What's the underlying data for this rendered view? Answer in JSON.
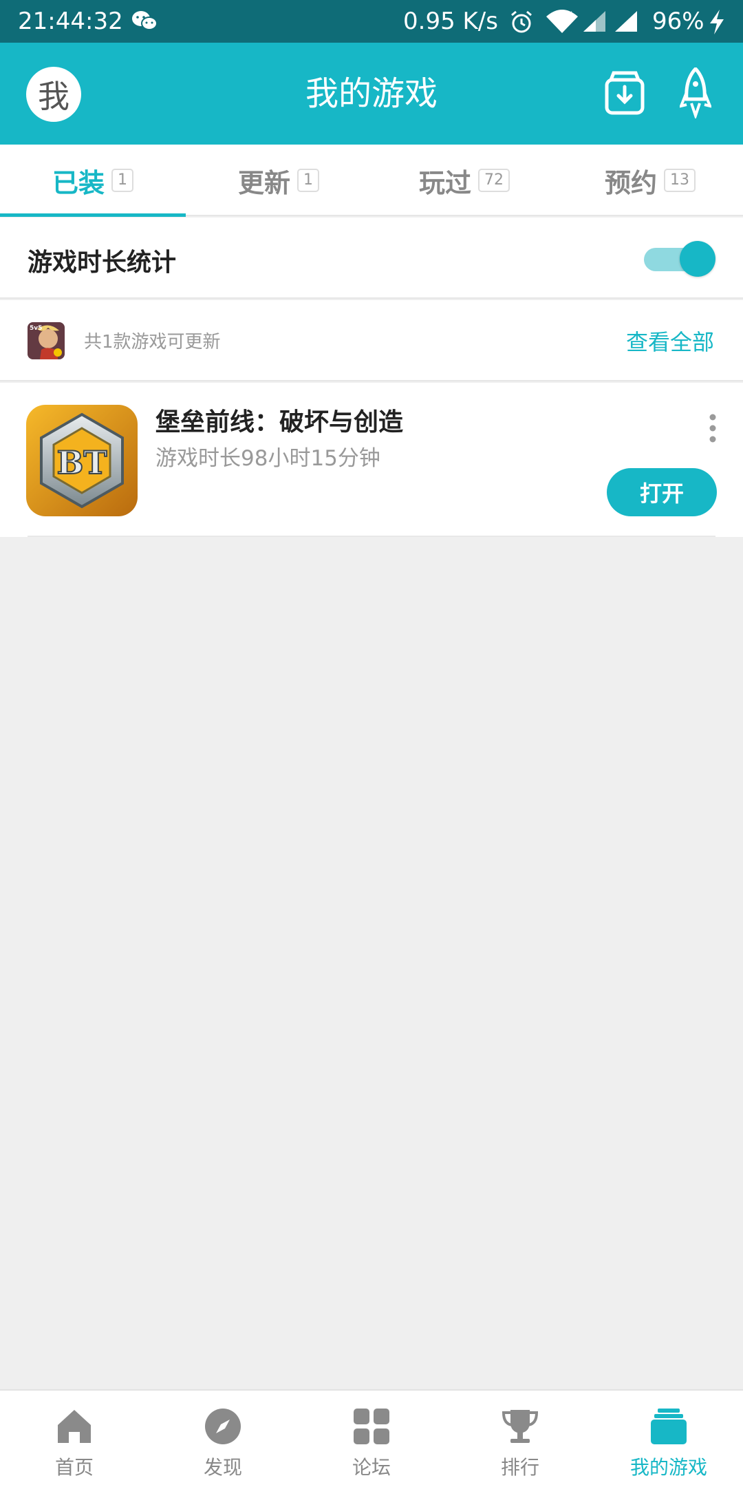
{
  "status_bar": {
    "time": "21:44:32",
    "net_speed": "0.95 K/s",
    "battery": "96%",
    "icons": [
      "wechat-icon",
      "alarm-icon",
      "wifi-icon",
      "signal-icon",
      "battery-charging-icon"
    ]
  },
  "header": {
    "avatar_char": "我",
    "title": "我的游戏",
    "icons": [
      "download-icon",
      "rocket-icon"
    ]
  },
  "tabs": [
    {
      "label": "已装",
      "count": "1",
      "active": true
    },
    {
      "label": "更新",
      "count": "1",
      "active": false
    },
    {
      "label": "玩过",
      "count": "72",
      "active": false
    },
    {
      "label": "预约",
      "count": "13",
      "active": false
    }
  ],
  "stats": {
    "label": "游戏时长统计",
    "toggle_on": true
  },
  "update_notice": {
    "text": "共1款游戏可更新",
    "view_all": "查看全部"
  },
  "games": [
    {
      "name": "堡垒前线：破坏与创造",
      "play_time": "游戏时长98小时15分钟",
      "action": "打开",
      "icon_text": "BT"
    }
  ],
  "bottom_nav": [
    {
      "label": "首页",
      "icon": "home-icon",
      "active": false
    },
    {
      "label": "发现",
      "icon": "compass-icon",
      "active": false
    },
    {
      "label": "论坛",
      "icon": "forum-grid-icon",
      "active": false
    },
    {
      "label": "排行",
      "icon": "trophy-icon",
      "active": false
    },
    {
      "label": "我的游戏",
      "icon": "my-games-icon",
      "active": true
    }
  ],
  "colors": {
    "accent": "#17b7c6",
    "status_bar": "#0f6c77",
    "background": "#efefef"
  }
}
